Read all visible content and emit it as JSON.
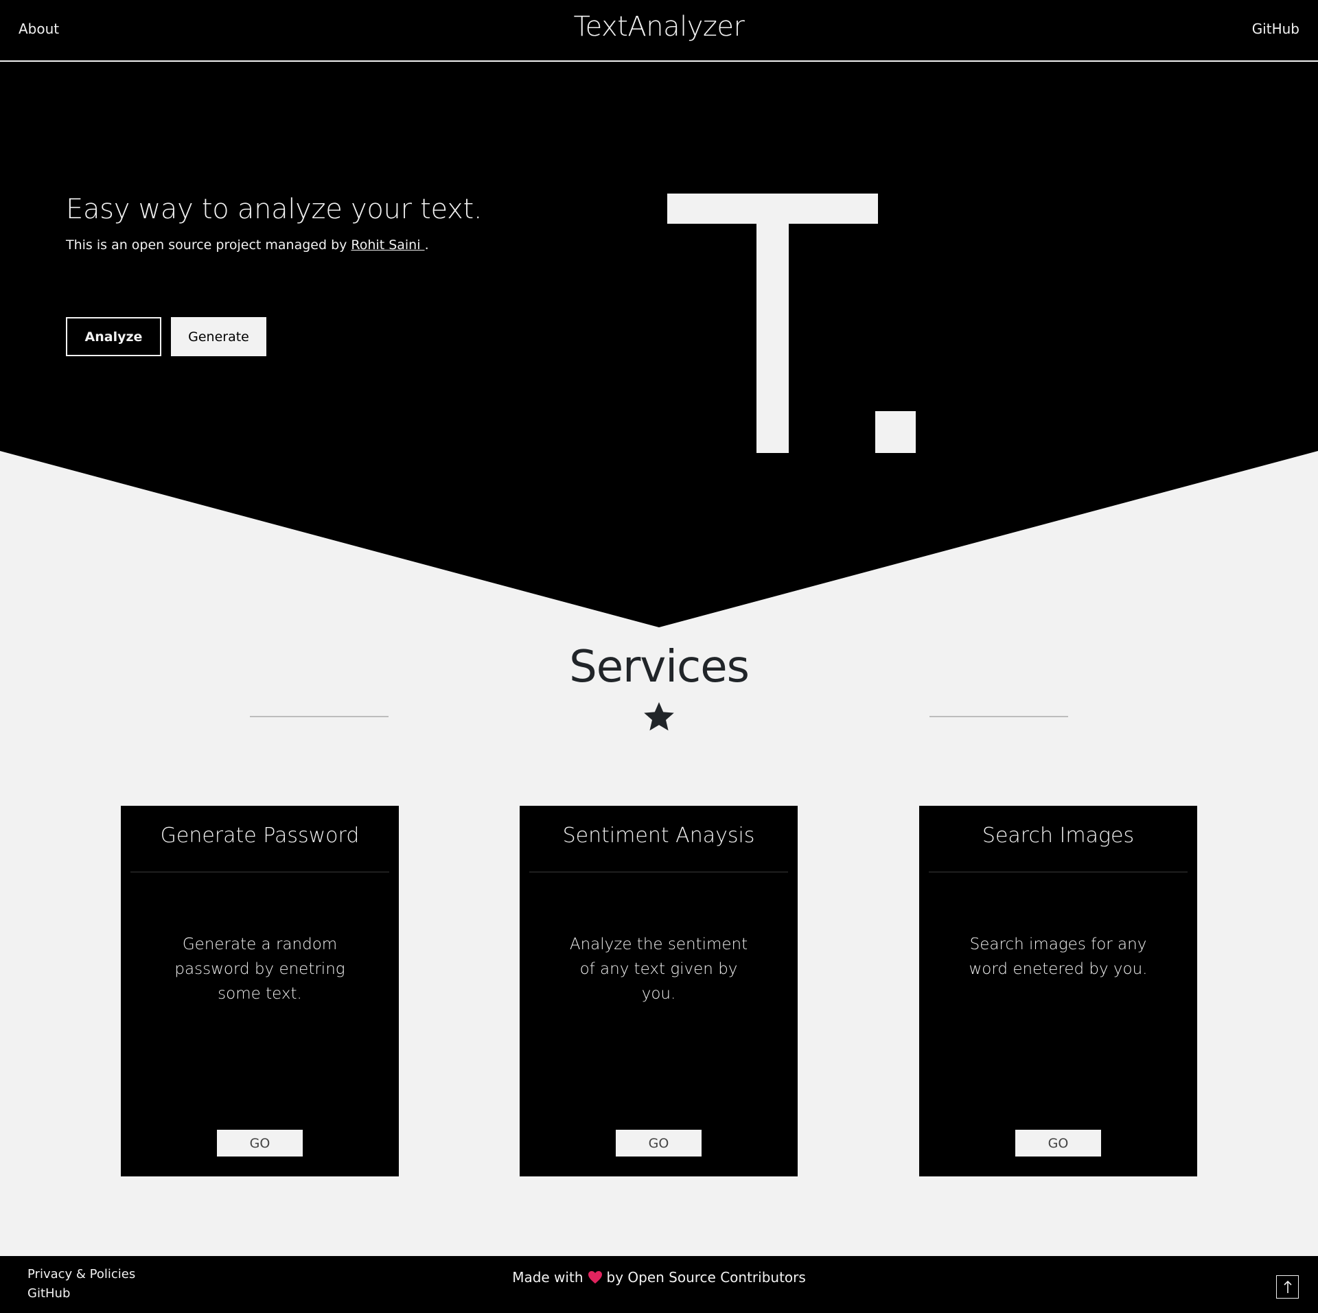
{
  "nav": {
    "brand": "TextAnalyzer",
    "about_label": "About",
    "github_label": "GitHub"
  },
  "hero": {
    "title": "Easy way to analyze your text.",
    "subtitle_prefix": "This is an open source project managed by ",
    "author_link": "Rohit Saini ",
    "subtitle_suffix": ".",
    "analyze_label": "Analyze",
    "generate_label": "Generate",
    "logo_letter_icon": "T.-logo-icon"
  },
  "services": {
    "title": "Services",
    "divider_icon": "star-icon",
    "cards": [
      {
        "title": "Generate Password",
        "description": "Generate a random password by enetring some text.",
        "button_label": "GO"
      },
      {
        "title": "Sentiment Anaysis",
        "description": "Analyze the sentiment of any text given by you.",
        "button_label": "GO"
      },
      {
        "title": "Search Images",
        "description": "Search images for any word enetered by you.",
        "button_label": "GO"
      }
    ]
  },
  "footer": {
    "privacy_label": "Privacy & Policies",
    "github_label": "GitHub",
    "credit_prefix": "Made with",
    "credit_icon": "heart-icon",
    "credit_suffix": "by Open Source Contributors",
    "top_button_icon": "arrow-up-icon"
  },
  "colors": {
    "background": "#f2f2f2",
    "dark": "#000000",
    "light": "#f2f2f2",
    "heading": "#212529",
    "heart": "#e0245e"
  }
}
